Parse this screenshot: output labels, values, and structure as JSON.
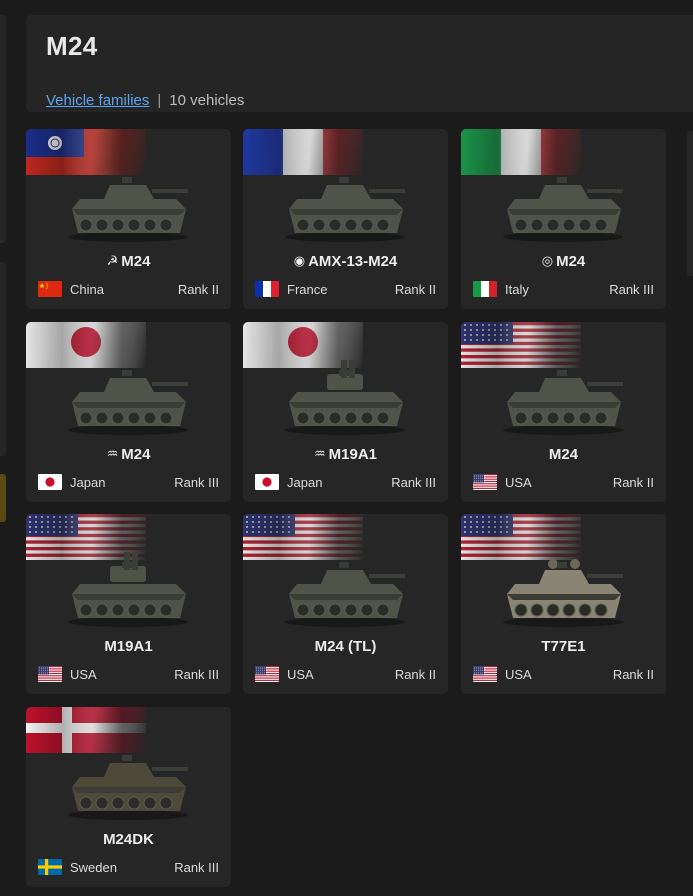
{
  "header": {
    "title": "M24",
    "families_link": "Vehicle families",
    "separator": "|",
    "count": "10 vehicles"
  },
  "vehicles": [
    {
      "name": "M24",
      "prefix": "☭",
      "country": "China",
      "flag": "china-flag-icon",
      "rank": "Rank II",
      "banner": "china"
    },
    {
      "name": "AMX-13-M24",
      "prefix": "◉",
      "country": "France",
      "flag": "france-flag-icon",
      "rank": "Rank II",
      "banner": "france"
    },
    {
      "name": "M24",
      "prefix": "◎",
      "country": "Italy",
      "flag": "italy-flag-icon",
      "rank": "Rank III",
      "banner": "italy"
    },
    {
      "name": "M24",
      "prefix": "♒",
      "country": "Japan",
      "flag": "japan-flag-icon",
      "rank": "Rank III",
      "banner": "japan"
    },
    {
      "name": "M19A1",
      "prefix": "♒",
      "country": "Japan",
      "flag": "japan-flag-icon",
      "rank": "Rank III",
      "banner": "japan"
    },
    {
      "name": "M24",
      "prefix": "",
      "country": "USA",
      "flag": "usa-flag-icon",
      "rank": "Rank II",
      "banner": "usa"
    },
    {
      "name": "M19A1",
      "prefix": "",
      "country": "USA",
      "flag": "usa-flag-icon",
      "rank": "Rank III",
      "banner": "usa"
    },
    {
      "name": "M24 (TL)",
      "prefix": "",
      "country": "USA",
      "flag": "usa-flag-icon",
      "rank": "Rank II",
      "banner": "usa"
    },
    {
      "name": "T77E1",
      "prefix": "",
      "country": "USA",
      "flag": "usa-flag-icon",
      "rank": "Rank II",
      "banner": "usa"
    },
    {
      "name": "M24DK",
      "prefix": "",
      "country": "Sweden",
      "flag": "sweden-flag-icon",
      "rank": "Rank III",
      "banner": "denmark"
    }
  ],
  "colors": {
    "link": "#5aa6f0",
    "card_bg": "#262626",
    "page_bg": "#1b1b1b"
  }
}
